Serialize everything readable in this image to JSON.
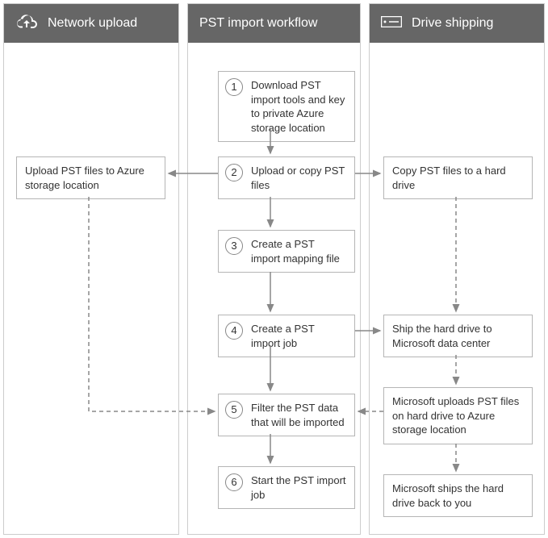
{
  "columns": {
    "left": {
      "title": "Network upload"
    },
    "mid": {
      "title": "PST import workflow"
    },
    "right": {
      "title": "Drive shipping"
    }
  },
  "steps": {
    "s1": {
      "num": "1",
      "text": "Download PST import tools and key to private Azure storage location"
    },
    "s2": {
      "num": "2",
      "text": "Upload or copy PST files"
    },
    "s3": {
      "num": "3",
      "text": "Create a PST import mapping file"
    },
    "s4": {
      "num": "4",
      "text": "Create a PST import job"
    },
    "s5": {
      "num": "5",
      "text": "Filter the PST data that will be imported"
    },
    "s6": {
      "num": "6",
      "text": "Start the PST import job"
    }
  },
  "left_boxes": {
    "upload": "Upload PST files to Azure storage location"
  },
  "right_boxes": {
    "copy": "Copy PST files to a hard drive",
    "ship": "Ship the hard drive to Microsoft data center",
    "ms_upload": "Microsoft uploads PST files on hard drive to Azure storage location",
    "ms_ship_back": "Microsoft ships the hard drive back to you"
  }
}
